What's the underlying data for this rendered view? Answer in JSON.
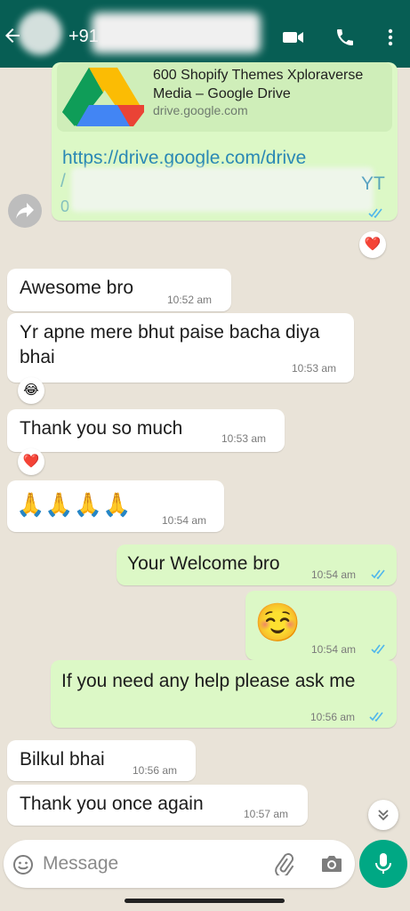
{
  "header": {
    "phone_prefix": "+91",
    "icons": [
      "back-arrow-icon",
      "video-call-icon",
      "voice-call-icon",
      "more-options-icon"
    ],
    "color": "#075e54"
  },
  "link_message": {
    "preview_title": "600 Shopify Themes Xploraverse Media – Google Drive",
    "preview_domain": "drive.google.com",
    "url": "https://drive.google.com/drive",
    "url_tail": "YT"
  },
  "messages": [
    {
      "text": "Awesome bro",
      "time": "10:52 am",
      "direction": "in"
    },
    {
      "text": "Yr apne mere bhut paise bacha diya bhai",
      "time": "10:53 am",
      "direction": "in",
      "reaction": "😂"
    },
    {
      "text": "Thank you so much",
      "time": "10:53 am",
      "direction": "in",
      "reaction": "❤️"
    },
    {
      "text": "🙏🙏🙏🙏",
      "time": "10:54 am",
      "direction": "in"
    },
    {
      "text": "Your Welcome bro",
      "time": "10:54 am",
      "direction": "out",
      "status": "read"
    },
    {
      "text": "☺️",
      "time": "10:54 am",
      "direction": "out",
      "status": "read"
    },
    {
      "text": "If you need any help please ask me",
      "time": "10:56 am",
      "direction": "out",
      "status": "read"
    },
    {
      "text": "Bilkul bhai",
      "time": "10:56 am",
      "direction": "in"
    },
    {
      "text": "Thank you once again",
      "time": "10:57 am",
      "direction": "in"
    }
  ],
  "link_reaction": "❤️",
  "composer": {
    "placeholder": "Message",
    "icons": [
      "emoji-icon",
      "attach-icon",
      "camera-icon",
      "mic-icon"
    ]
  },
  "colors": {
    "incoming": "#ffffff",
    "outgoing": "#dcf8c6",
    "read_ticks": "#4fb6ec",
    "send_button": "#00a884"
  }
}
